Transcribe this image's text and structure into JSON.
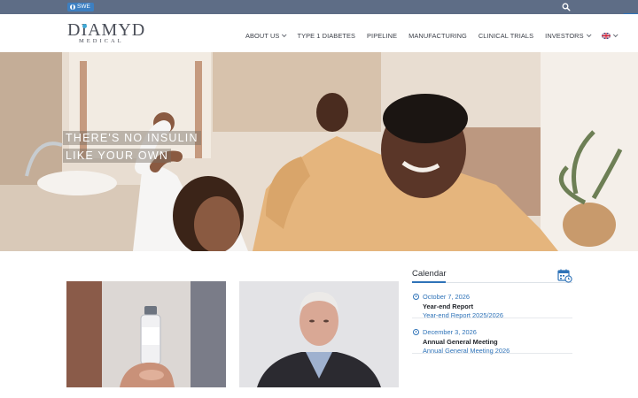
{
  "topbar": {
    "language_badge": "SWE",
    "search_icon": "search-icon",
    "cart_icon": "cart-icon"
  },
  "logo": {
    "main": "DIAMYD",
    "sub": "MEDICAL"
  },
  "nav": {
    "items": [
      {
        "label": "ABOUT US",
        "has_dropdown": true
      },
      {
        "label": "TYPE 1 DIABETES",
        "has_dropdown": false
      },
      {
        "label": "PIPELINE",
        "has_dropdown": false
      },
      {
        "label": "MANUFACTURING",
        "has_dropdown": false
      },
      {
        "label": "CLINICAL TRIALS",
        "has_dropdown": false
      },
      {
        "label": "INVESTORS",
        "has_dropdown": true
      }
    ],
    "language_flag": "uk-flag-icon"
  },
  "hero": {
    "line1": "THERE'S NO INSULIN",
    "line2": "LIKE YOUR OWN"
  },
  "calendar": {
    "title": "Calendar",
    "events": [
      {
        "date": "October 7, 2026",
        "title": "Year-end Report",
        "description": "Year-end Report 2025/2026"
      },
      {
        "date": "December 3, 2026",
        "title": "Annual General Meeting",
        "description": "Annual General Meeting 2026"
      }
    ]
  },
  "colors": {
    "topbar": "#5e6d86",
    "accent": "#2f73b8",
    "logo_dot": "#3fa9d6"
  }
}
